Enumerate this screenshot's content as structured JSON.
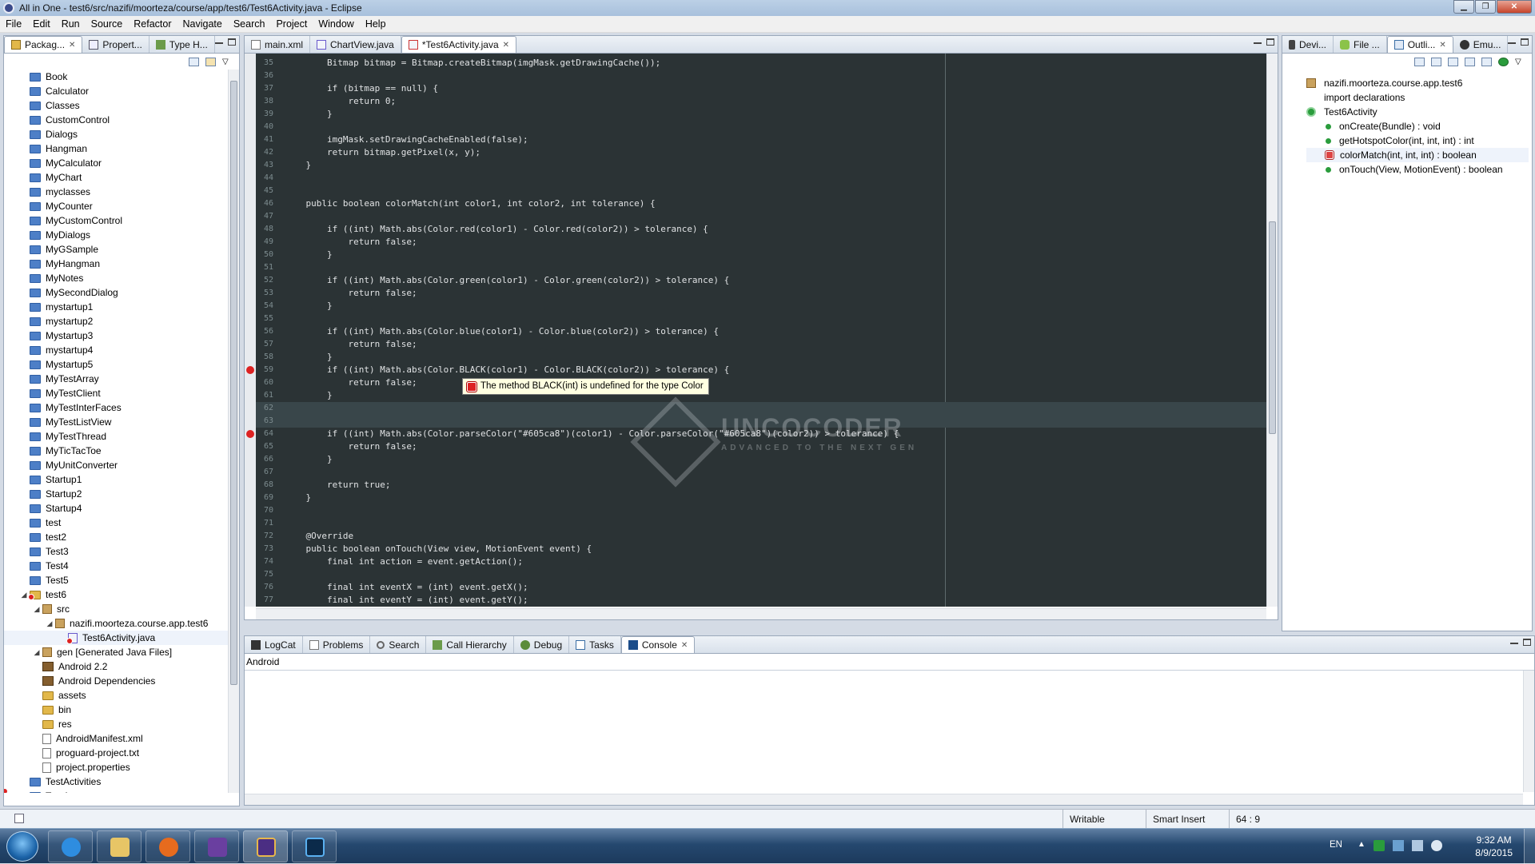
{
  "window": {
    "title": "All in One - test6/src/nazifi/moorteza/course/app/test6/Test6Activity.java - Eclipse"
  },
  "menu": [
    "File",
    "Edit",
    "Run",
    "Source",
    "Refactor",
    "Navigate",
    "Search",
    "Project",
    "Window",
    "Help"
  ],
  "left_panel": {
    "tabs": [
      "Packag...",
      "Propert...",
      "Type H..."
    ],
    "items": [
      {
        "label": "Book",
        "kind": "folder"
      },
      {
        "label": "Calculator",
        "kind": "folder"
      },
      {
        "label": "Classes",
        "kind": "folder"
      },
      {
        "label": "CustomControl",
        "kind": "folder"
      },
      {
        "label": "Dialogs",
        "kind": "folder"
      },
      {
        "label": "Hangman",
        "kind": "folder"
      },
      {
        "label": "MyCalculator",
        "kind": "folder"
      },
      {
        "label": "MyChart",
        "kind": "folder"
      },
      {
        "label": "myclasses",
        "kind": "folder"
      },
      {
        "label": "MyCounter",
        "kind": "folder"
      },
      {
        "label": "MyCustomControl",
        "kind": "folder"
      },
      {
        "label": "MyDialogs",
        "kind": "folder"
      },
      {
        "label": "MyGSample",
        "kind": "folder"
      },
      {
        "label": "MyHangman",
        "kind": "folder"
      },
      {
        "label": "MyNotes",
        "kind": "folder"
      },
      {
        "label": "MySecondDialog",
        "kind": "folder"
      },
      {
        "label": "mystartup1",
        "kind": "folder"
      },
      {
        "label": "mystartup2",
        "kind": "folder"
      },
      {
        "label": "Mystartup3",
        "kind": "folder"
      },
      {
        "label": "mystartup4",
        "kind": "folder"
      },
      {
        "label": "Mystartup5",
        "kind": "folder"
      },
      {
        "label": "MyTestArray",
        "kind": "folder"
      },
      {
        "label": "MyTestClient",
        "kind": "folder"
      },
      {
        "label": "MyTestInterFaces",
        "kind": "folder"
      },
      {
        "label": "MyTestListView",
        "kind": "folder"
      },
      {
        "label": "MyTestThread",
        "kind": "folder"
      },
      {
        "label": "MyTicTacToe",
        "kind": "folder"
      },
      {
        "label": "MyUnitConverter",
        "kind": "folder"
      },
      {
        "label": "Startup1",
        "kind": "folder"
      },
      {
        "label": "Startup2",
        "kind": "folder"
      },
      {
        "label": "Startup4",
        "kind": "folder"
      },
      {
        "label": "test",
        "kind": "folder"
      },
      {
        "label": "test2",
        "kind": "folder"
      },
      {
        "label": "Test3",
        "kind": "folder"
      },
      {
        "label": "Test4",
        "kind": "folder"
      },
      {
        "label": "Test5",
        "kind": "folder"
      },
      {
        "label": "test6",
        "kind": "openproj"
      },
      {
        "label": "src",
        "kind": "src"
      },
      {
        "label": "nazifi.moorteza.course.app.test6",
        "kind": "pkg"
      },
      {
        "label": "Test6Activity.java",
        "kind": "java"
      },
      {
        "label": "gen [Generated Java Files]",
        "kind": "src"
      },
      {
        "label": "Android 2.2",
        "kind": "lib"
      },
      {
        "label": "Android Dependencies",
        "kind": "lib"
      },
      {
        "label": "assets",
        "kind": "dir"
      },
      {
        "label": "bin",
        "kind": "dir"
      },
      {
        "label": "res",
        "kind": "dir"
      },
      {
        "label": "AndroidManifest.xml",
        "kind": "file"
      },
      {
        "label": "proguard-project.txt",
        "kind": "file"
      },
      {
        "label": "project.properties",
        "kind": "file"
      },
      {
        "label": "TestActivities",
        "kind": "folder"
      },
      {
        "label": "TestArray",
        "kind": "folder"
      }
    ]
  },
  "editor": {
    "tabs": [
      "main.xml",
      "ChartView.java",
      "*Test6Activity.java"
    ],
    "lines": [
      {
        "n": "35",
        "t": "        Bitmap bitmap = Bitmap.createBitmap(imgMask.getDrawingCache());"
      },
      {
        "n": "36",
        "t": ""
      },
      {
        "n": "37",
        "t": "        if (bitmap == null) {"
      },
      {
        "n": "38",
        "t": "            return 0;"
      },
      {
        "n": "39",
        "t": "        }"
      },
      {
        "n": "40",
        "t": ""
      },
      {
        "n": "41",
        "t": "        imgMask.setDrawingCacheEnabled(false);"
      },
      {
        "n": "42",
        "t": "        return bitmap.getPixel(x, y);"
      },
      {
        "n": "43",
        "t": "    }"
      },
      {
        "n": "44",
        "t": ""
      },
      {
        "n": "45",
        "t": ""
      },
      {
        "n": "46",
        "t": "    public boolean colorMatch(int color1, int color2, int tolerance) {"
      },
      {
        "n": "47",
        "t": ""
      },
      {
        "n": "48",
        "t": "        if ((int) Math.abs(Color.red(color1) - Color.red(color2)) > tolerance) {"
      },
      {
        "n": "49",
        "t": "            return false;"
      },
      {
        "n": "50",
        "t": "        }"
      },
      {
        "n": "51",
        "t": ""
      },
      {
        "n": "52",
        "t": "        if ((int) Math.abs(Color.green(color1) - Color.green(color2)) > tolerance) {"
      },
      {
        "n": "53",
        "t": "            return false;"
      },
      {
        "n": "54",
        "t": "        }"
      },
      {
        "n": "55",
        "t": ""
      },
      {
        "n": "56",
        "t": "        if ((int) Math.abs(Color.blue(color1) - Color.blue(color2)) > tolerance) {"
      },
      {
        "n": "57",
        "t": "            return false;"
      },
      {
        "n": "58",
        "t": "        }"
      },
      {
        "n": "59",
        "t": "        if ((int) Math.abs(Color.BLACK(color1) - Color.BLACK(color2)) > tolerance) {"
      },
      {
        "n": "60",
        "t": "            return false;"
      },
      {
        "n": "61",
        "t": "        }"
      },
      {
        "n": "62",
        "t": ""
      },
      {
        "n": "63",
        "t": ""
      },
      {
        "n": "64",
        "t": "        if ((int) Math.abs(Color.parseColor(\"#605ca8\")(color1) - Color.parseColor(\"#605ca8\")(color2)) > tolerance) {"
      },
      {
        "n": "65",
        "t": "            return false;"
      },
      {
        "n": "66",
        "t": "        }"
      },
      {
        "n": "67",
        "t": ""
      },
      {
        "n": "68",
        "t": "        return true;"
      },
      {
        "n": "69",
        "t": "    }"
      },
      {
        "n": "70",
        "t": ""
      },
      {
        "n": "71",
        "t": ""
      },
      {
        "n": "72",
        "t": "    @Override"
      },
      {
        "n": "73",
        "t": "    public boolean onTouch(View view, MotionEvent event) {"
      },
      {
        "n": "74",
        "t": "        final int action = event.getAction();"
      },
      {
        "n": "75",
        "t": ""
      },
      {
        "n": "76",
        "t": "        final int eventX = (int) event.getX();"
      },
      {
        "n": "77",
        "t": "        final int eventY = (int) event.getY();"
      }
    ],
    "tooltip": "The method BLACK(int) is undefined for the type Color",
    "watermark": "UNCOCODER",
    "watermark_sub": "ADVANCED TO THE NEXT GEN"
  },
  "right_panel": {
    "tabs": [
      "Devi...",
      "File ...",
      "Outli...",
      "Emu..."
    ],
    "outline": [
      {
        "label": "nazifi.moorteza.course.app.test6",
        "kind": "pkg"
      },
      {
        "label": "import declarations",
        "kind": "imp"
      },
      {
        "label": "Test6Activity",
        "kind": "class"
      },
      {
        "label": "onCreate(Bundle) : void",
        "kind": "method"
      },
      {
        "label": "getHotspotColor(int, int, int) : int",
        "kind": "method"
      },
      {
        "label": "colorMatch(int, int, int) : boolean",
        "kind": "error"
      },
      {
        "label": "onTouch(View, MotionEvent) : boolean",
        "kind": "method"
      }
    ]
  },
  "bottom_panel": {
    "tabs": [
      "LogCat",
      "Problems",
      "Search",
      "Call Hierarchy",
      "Debug",
      "Tasks",
      "Console"
    ],
    "console_label": "Android"
  },
  "status": {
    "writable": "Writable",
    "insert": "Smart Insert",
    "position": "64 : 9"
  },
  "taskbar": {
    "lang": "EN",
    "time": "9:32 AM",
    "date": "8/9/2015"
  },
  "colors": {
    "accent": "#3a6ea5",
    "editor_bg": "#2b3335",
    "error": "#d22222"
  }
}
